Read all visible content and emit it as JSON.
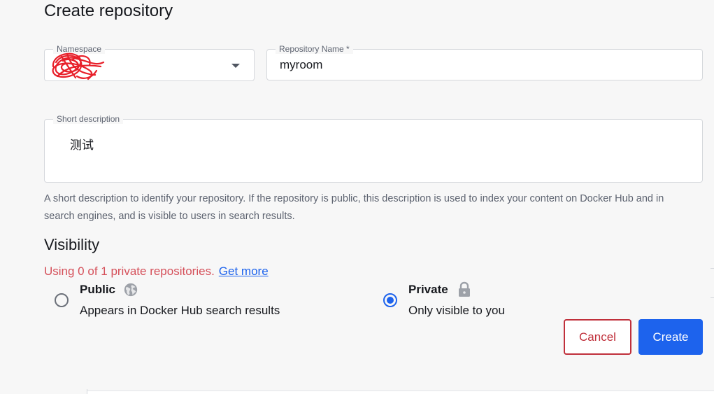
{
  "page": {
    "title": "Create repository"
  },
  "form": {
    "namespace": {
      "label": "Namespace",
      "value": ""
    },
    "repository_name": {
      "label": "Repository Name *",
      "value": "myroom"
    },
    "short_description": {
      "label": "Short description",
      "value": "测试",
      "helper": "A short description to identify your repository. If the repository is public, this description is used to index your content on Docker Hub and in search engines, and is visible to users in search results."
    }
  },
  "visibility": {
    "title": "Visibility",
    "usage_text": "Using 0 of 1 private repositories.",
    "get_more_link": "Get more",
    "options": [
      {
        "label": "Public",
        "description": "Appears in Docker Hub search results",
        "icon": "globe-icon",
        "selected": false
      },
      {
        "label": "Private",
        "description": "Only visible to you",
        "icon": "lock-icon",
        "selected": true
      }
    ]
  },
  "actions": {
    "cancel_label": "Cancel",
    "create_label": "Create"
  },
  "colors": {
    "primary": "#1d63ed",
    "danger": "#c0303b",
    "warning_text": "#d5505a",
    "background": "#f7f7f7"
  }
}
